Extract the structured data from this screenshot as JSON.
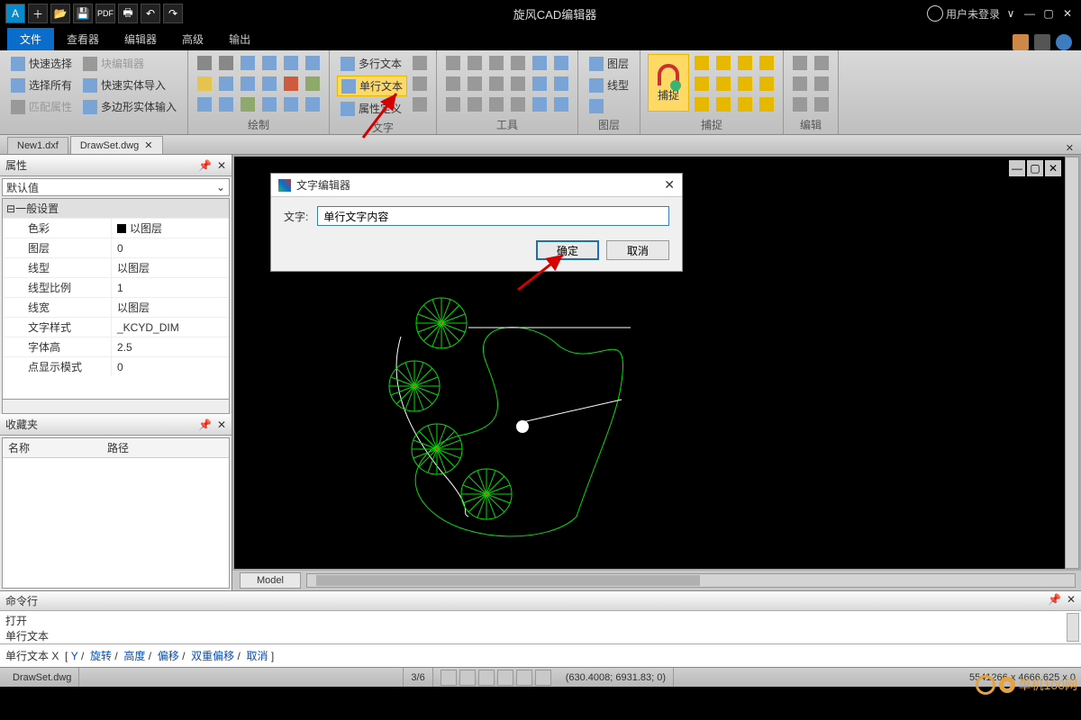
{
  "titlebar": {
    "title": "旋风CAD编辑器",
    "user": "用户未登录"
  },
  "menu": {
    "file": "文件",
    "viewer": "查看器",
    "editor": "编辑器",
    "advanced": "高级",
    "output": "输出"
  },
  "ribbon": {
    "sel_fast": "快速选择",
    "sel_all": "选择所有",
    "sel_match": "匹配属性",
    "blk_editor": "块编辑器",
    "blk_import": "快速实体导入",
    "blk_poly": "多边形实体输入",
    "group_draw": "绘制",
    "txt_multi": "多行文本",
    "txt_single": "单行文本",
    "txt_attr": "属性定义",
    "group_text": "文字",
    "group_tools": "工具",
    "layer": "图层",
    "linetype": "线型",
    "group_layers": "图层",
    "snap_big": "捕捉",
    "group_snap": "捕捉",
    "group_edit": "编辑"
  },
  "filetabs": {
    "tab1": "New1.dxf",
    "tab2": "DrawSet.dwg"
  },
  "proppanel": {
    "title": "属性",
    "dropdown": "默认值",
    "cat_general": "一般设置",
    "r_color_k": "色彩",
    "r_color_v": "以图层",
    "r_layer_k": "图层",
    "r_layer_v": "0",
    "r_ltype_k": "线型",
    "r_ltype_v": "以图层",
    "r_lscale_k": "线型比例",
    "r_lscale_v": "1",
    "r_lw_k": "线宽",
    "r_lw_v": "以图层",
    "r_tstyle_k": "文字样式",
    "r_tstyle_v": "_KCYD_DIM",
    "r_th_k": "字体高",
    "r_th_v": "2.5",
    "r_pd_k": "点显示模式",
    "r_pd_v": "0"
  },
  "favpanel": {
    "title": "收藏夹",
    "col_name": "名称",
    "col_path": "路径"
  },
  "dialog": {
    "title": "文字编辑器",
    "label": "文字:",
    "value": "单行文字内容",
    "ok": "确定",
    "cancel": "取消"
  },
  "model": {
    "tab": "Model"
  },
  "cmd": {
    "title": "命令行",
    "l1": "打开",
    "l2": "单行文本",
    "prompt_pre": "单行文本 X",
    "y": "Y",
    "rotate": "旋转",
    "height": "高度",
    "offset": "偏移",
    "doffset": "双重偏移",
    "cancel": "取消"
  },
  "status": {
    "file": "DrawSet.dwg",
    "page": "3/6",
    "coords": "(630.4008; 6931.83; 0)",
    "zoom": "5541266 x 4666.625 x 0"
  },
  "watermark": "单机100网"
}
